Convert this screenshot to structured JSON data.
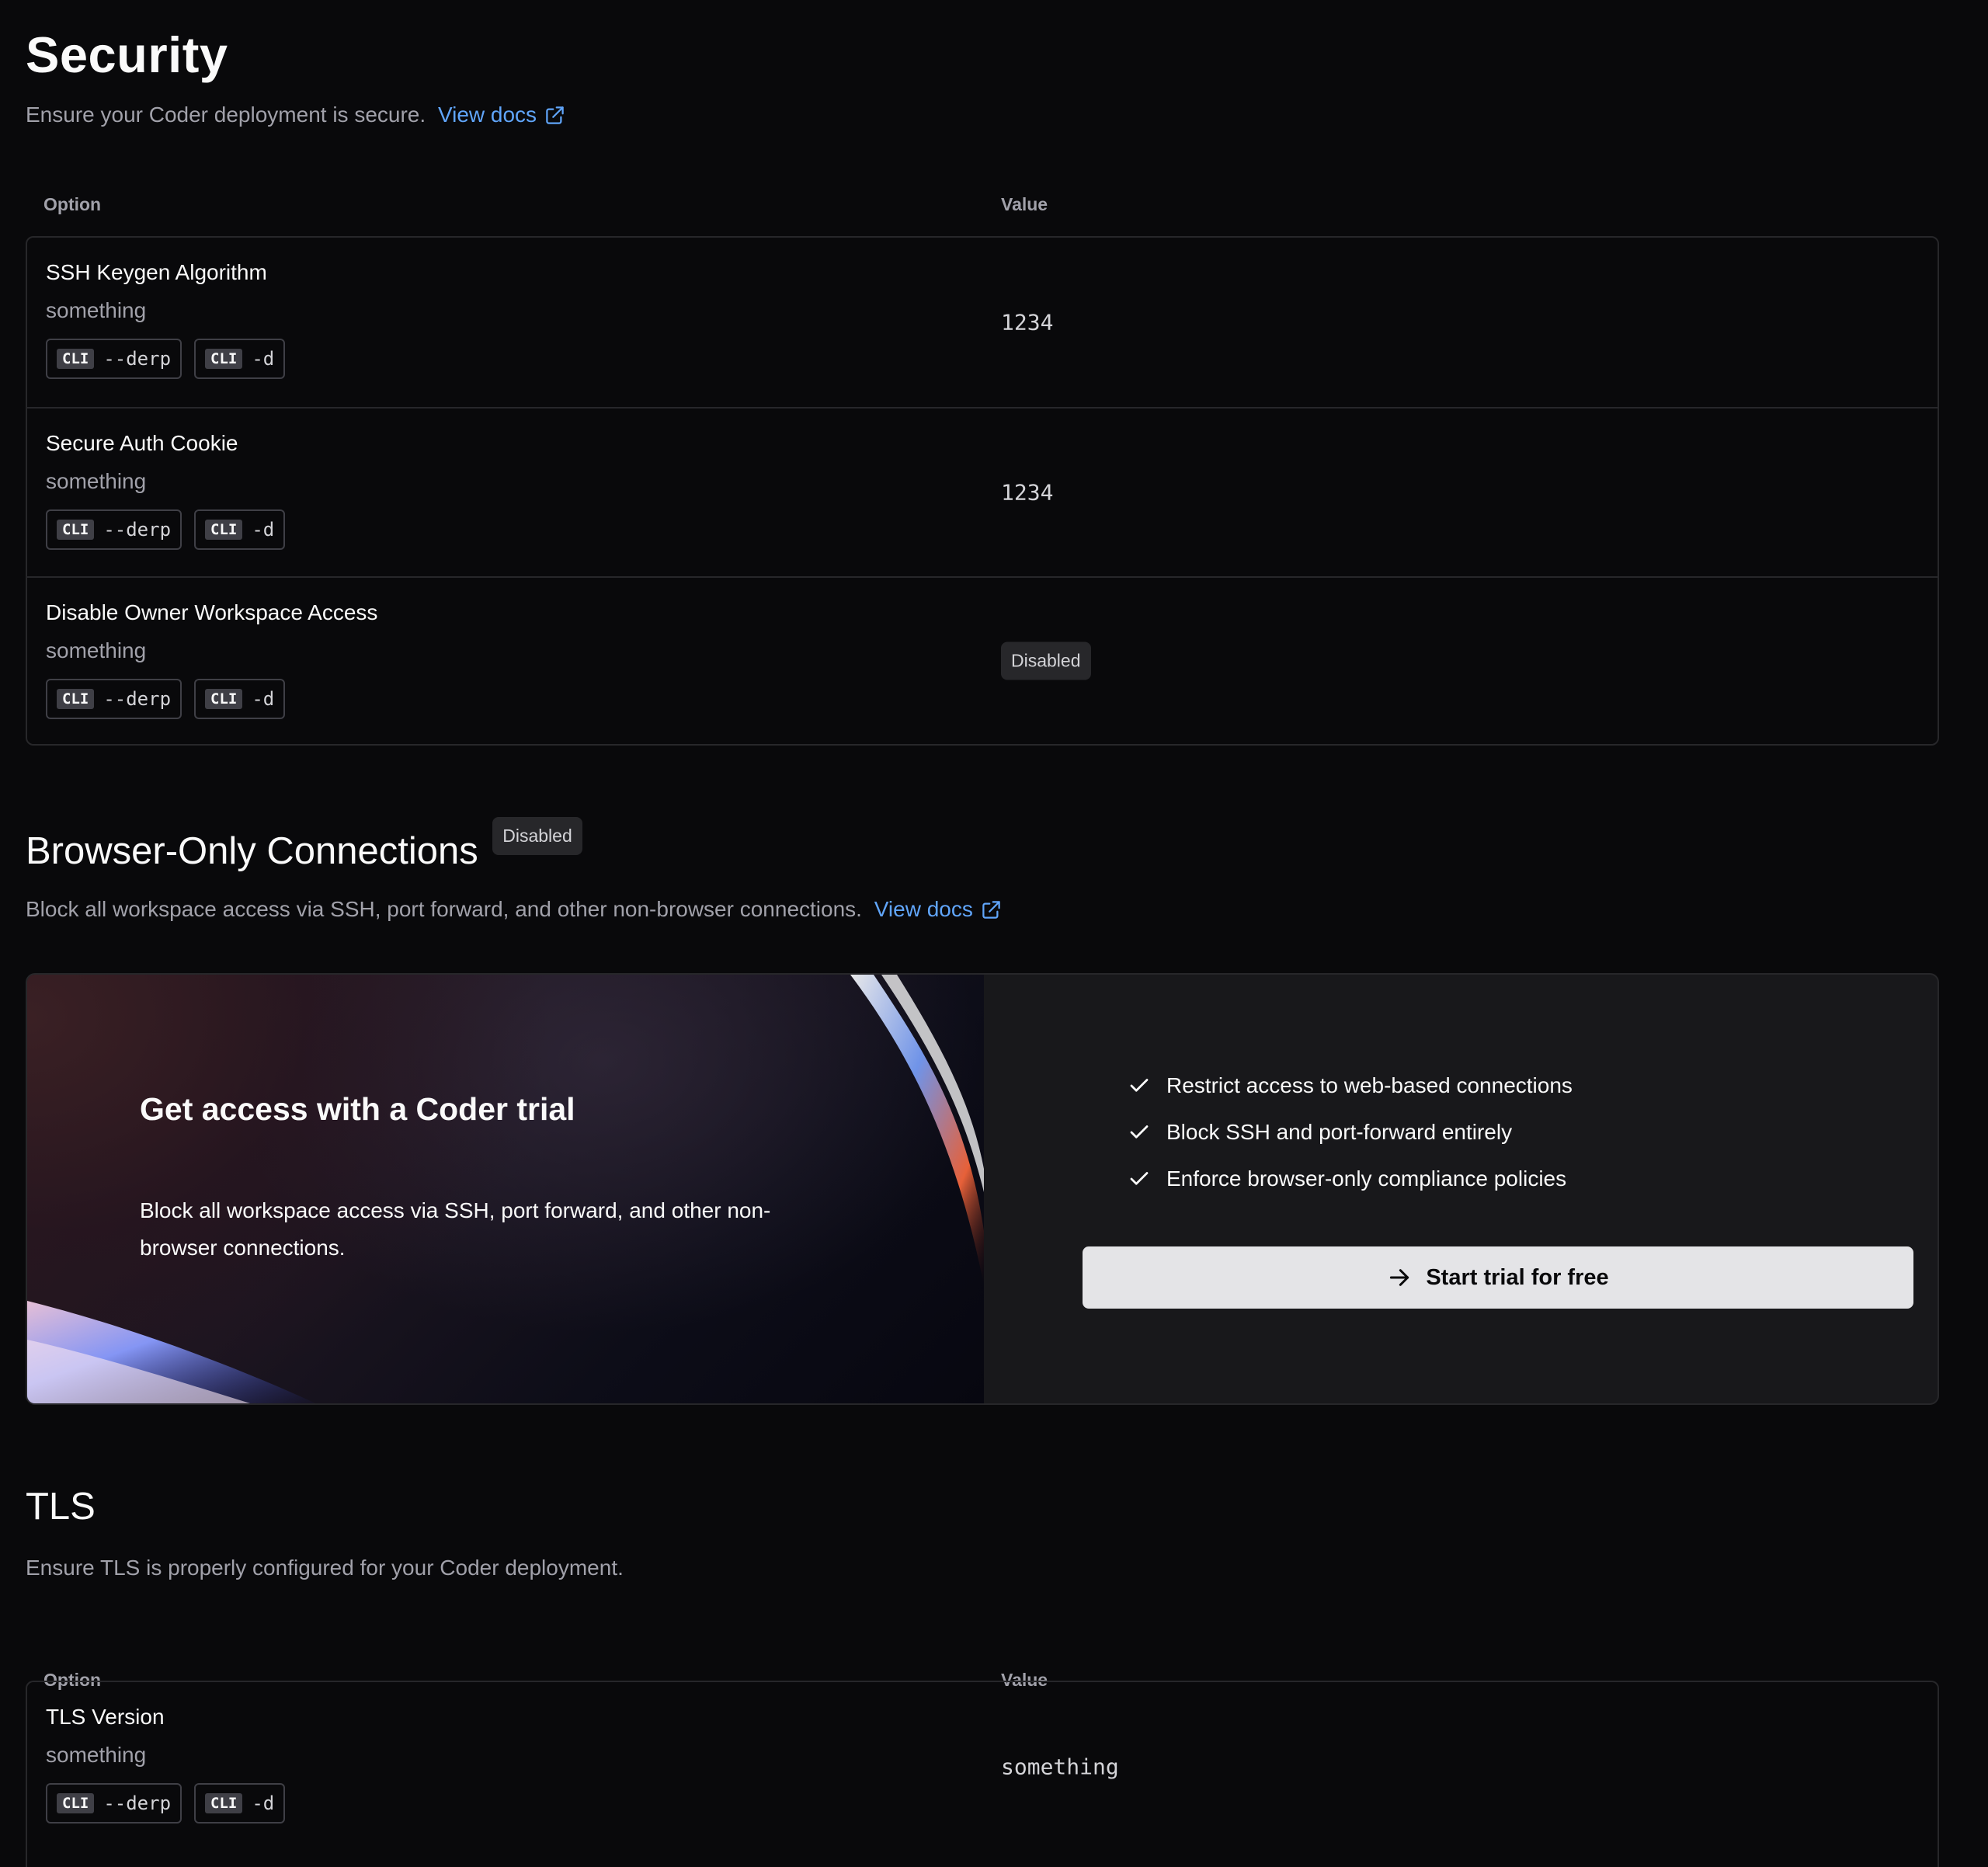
{
  "security": {
    "title": "Security",
    "description": "Ensure your Coder deployment is secure.",
    "docs_link": "View docs",
    "columns": {
      "option": "Option",
      "value": "Value"
    },
    "rows": [
      {
        "name": "SSH Keygen Algorithm",
        "description": "something",
        "cli_tag": "CLI",
        "flag1": "--derp",
        "flag2": "-d",
        "value": "1234"
      },
      {
        "name": "Secure Auth Cookie",
        "description": "something",
        "cli_tag": "CLI",
        "flag1": "--derp",
        "flag2": "-d",
        "value": "1234"
      },
      {
        "name": "Disable Owner Workspace Access",
        "description": "something",
        "cli_tag": "CLI",
        "flag1": "--derp",
        "flag2": "-d",
        "value": "Disabled"
      }
    ]
  },
  "browser_only": {
    "title": "Browser-Only Connections",
    "badge": "Disabled",
    "description": "Block all workspace access via SSH, port forward, and other non-browser connections.",
    "docs_link": "View docs",
    "promo": {
      "title": "Get access with a Coder trial",
      "text": "Block all workspace access via SSH, port forward, and other non-browser connections.",
      "features": [
        "Restrict access to web-based connections",
        "Block SSH and port-forward entirely",
        "Enforce browser-only compliance policies"
      ],
      "button": "Start trial for free"
    }
  },
  "tls": {
    "title": "TLS",
    "description": "Ensure TLS is properly configured for your Coder deployment.",
    "columns": {
      "option": "Option",
      "value": "Value"
    },
    "rows": [
      {
        "name": "TLS Version",
        "description": "something",
        "cli_tag": "CLI",
        "flag1": "--derp",
        "flag2": "-d",
        "value": "something"
      }
    ]
  },
  "colors": {
    "background": "#09090b",
    "link": "#60a5fa",
    "border": "#27272a",
    "button": "#e4e4e7"
  }
}
